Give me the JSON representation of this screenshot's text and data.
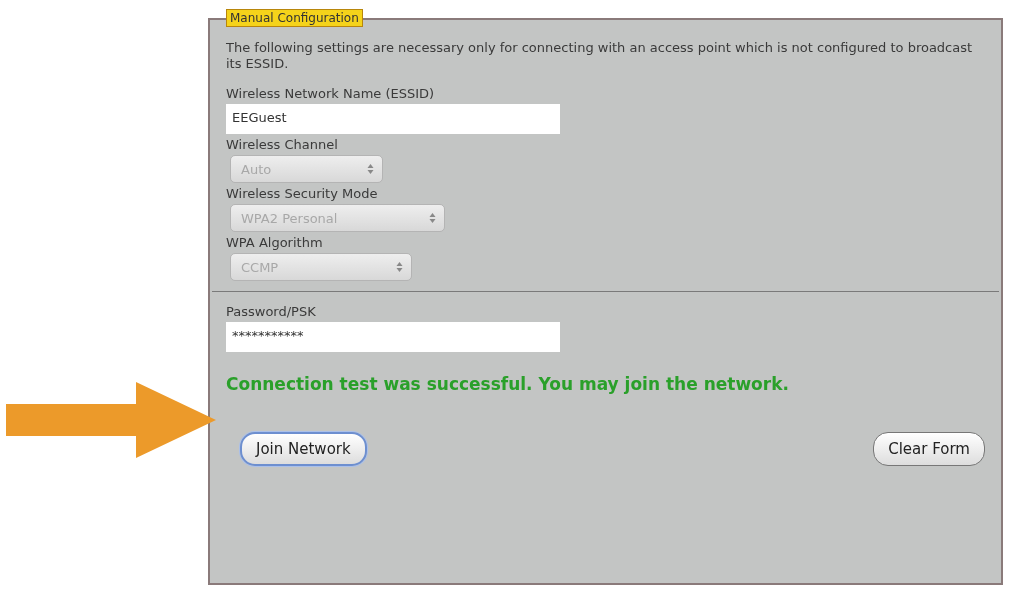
{
  "panel": {
    "legend": "Manual Configuration",
    "intro": "The following settings are necessary only for connecting with an access point which is not configured to broadcast its ESSID.",
    "fields": [
      {
        "kind": "text",
        "label": "Wireless Network Name (ESSID)",
        "value": "EEGuest"
      },
      {
        "kind": "select",
        "label": "Wireless Channel",
        "value": "Auto",
        "disabled": true
      },
      {
        "kind": "select",
        "label": "Wireless Security Mode",
        "value": "WPA2 Personal",
        "disabled": true
      },
      {
        "kind": "select",
        "label": "WPA Algorithm",
        "value": "CCMP",
        "disabled": true
      }
    ],
    "password": {
      "label": "Password/PSK",
      "value": "***********"
    },
    "message": "Connection test was successful. You may join the network.",
    "buttons": [
      {
        "label": "Join Network",
        "default": true
      },
      {
        "label": "Clear Form",
        "default": false
      }
    ]
  }
}
